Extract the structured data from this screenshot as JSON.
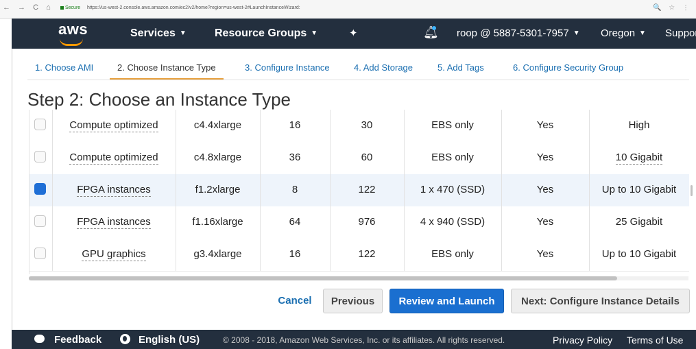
{
  "browser": {
    "nav_glyphs": "← → C ⌂",
    "secure": "Secure",
    "url": "https://us-west-2.console.aws.amazon.com/ec2/v2/home?region=us-west-2#LaunchInstanceWizard:",
    "right_glyphs": "🔍 ☆ ⋮"
  },
  "topbar": {
    "logo": "aws",
    "services": "Services",
    "resource_groups": "Resource Groups",
    "account": "roop @ 5887-5301-7957",
    "region": "Oregon",
    "support": "Suppor"
  },
  "wizard": {
    "tabs": [
      {
        "label": "1. Choose AMI"
      },
      {
        "label": "2. Choose Instance Type"
      },
      {
        "label": "3. Configure Instance"
      },
      {
        "label": "4. Add Storage"
      },
      {
        "label": "5. Add Tags"
      },
      {
        "label": "6. Configure Security Group"
      }
    ],
    "heading": "Step 2: Choose an Instance Type"
  },
  "table": {
    "rows": [
      {
        "family": "Compute optimized",
        "type": "c4.4xlarge",
        "vcpus": "16",
        "memory": "30",
        "storage": "EBS only",
        "ebs": "Yes",
        "network": "High",
        "selected": false
      },
      {
        "family": "Compute optimized",
        "type": "c4.8xlarge",
        "vcpus": "36",
        "memory": "60",
        "storage": "EBS only",
        "ebs": "Yes",
        "network": "10 Gigabit",
        "selected": false
      },
      {
        "family": "FPGA instances",
        "type": "f1.2xlarge",
        "vcpus": "8",
        "memory": "122",
        "storage": "1 x 470 (SSD)",
        "ebs": "Yes",
        "network": "Up to 10 Gigabit",
        "selected": true
      },
      {
        "family": "FPGA instances",
        "type": "f1.16xlarge",
        "vcpus": "64",
        "memory": "976",
        "storage": "4 x 940 (SSD)",
        "ebs": "Yes",
        "network": "25 Gigabit",
        "selected": false
      },
      {
        "family": "GPU graphics",
        "type": "g3.4xlarge",
        "vcpus": "16",
        "memory": "122",
        "storage": "EBS only",
        "ebs": "Yes",
        "network": "Up to 10 Gigabit",
        "selected": false
      }
    ]
  },
  "actions": {
    "cancel": "Cancel",
    "previous": "Previous",
    "review": "Review and Launch",
    "next": "Next: Configure Instance Details"
  },
  "footer": {
    "feedback": "Feedback",
    "language": "English (US)",
    "copyright": "© 2008 - 2018, Amazon Web Services, Inc. or its affiliates. All rights reserved.",
    "privacy": "Privacy Policy",
    "terms": "Terms of Use"
  },
  "colors": {
    "topbar_bg": "#232f3e",
    "accent_orange": "#ff9900",
    "primary_blue": "#1a6fd0",
    "link_blue": "#1b6fb1",
    "selected_row_bg": "#eef4fb"
  }
}
